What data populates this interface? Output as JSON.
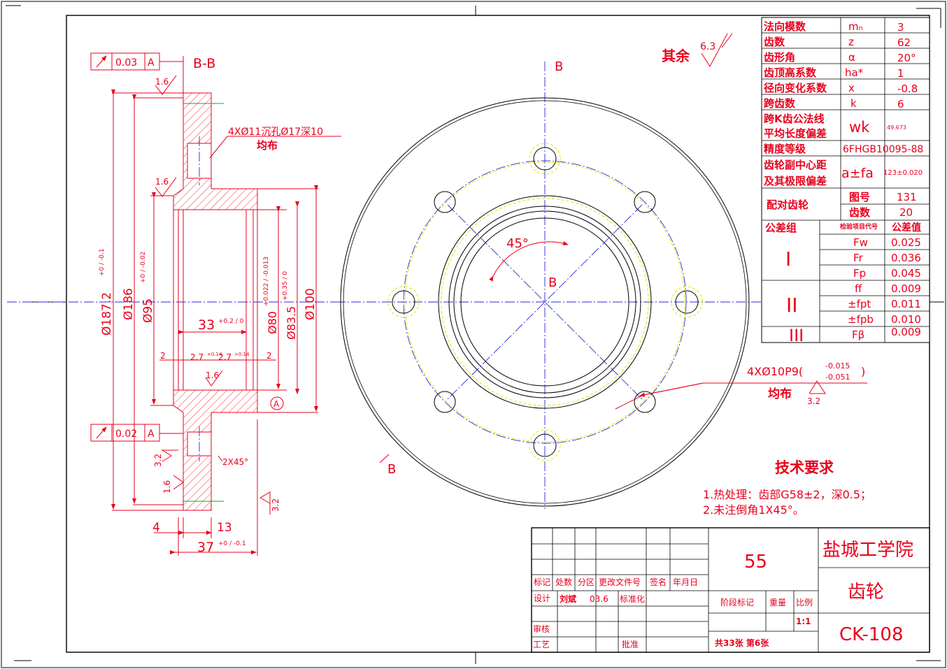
{
  "section_label": "B-B",
  "cut_labels": [
    "B",
    "B",
    "B"
  ],
  "tolerance_frames": [
    {
      "symbol": "↗",
      "value": "0.03",
      "datum": "A"
    },
    {
      "symbol": "↗",
      "value": "0.02",
      "datum": "A"
    }
  ],
  "surface_finish": {
    "general": "其余",
    "general_value": "6.3",
    "marks": [
      "1.6",
      "1.6",
      "1.6",
      "3.2",
      "1.6",
      "3.2",
      "3.2"
    ]
  },
  "callouts": {
    "counterbore": "4XØ11沉孔Ø17深10",
    "counterbore_sub": "均布",
    "pins": "4XØ10P9(",
    "pins_tol_upper": "-0.015",
    "pins_tol_lower": "-0.051",
    "pins_close": ")",
    "pins_sub": "均布",
    "chamfer": "2X45°",
    "angle": "45°",
    "datum": "A"
  },
  "dimensions": {
    "d187": "Ø187.2",
    "d187_tol": "+0 / -0.1",
    "d186": "Ø186",
    "d95": "Ø95",
    "d95_tol": "+0 / -0.02",
    "d80": "Ø80",
    "d80_tol": "+0.022 / -0.013",
    "d83": "Ø83.5",
    "d83_tol": "+0.35 / 0",
    "d100": "Ø100",
    "w33": "33",
    "w33_tol": "+0.2 / 0",
    "w2a": "2",
    "w2b": "2",
    "w27a": "2.7",
    "w27a_tol": "+0.14",
    "w27b": "2.7",
    "w27b_tol": "+0.14",
    "w4": "4",
    "w13": "13",
    "w37": "37",
    "w37_tol": "+0 / -0.1"
  },
  "gear_table": {
    "rows": [
      {
        "label": "法向模数",
        "sym": "mₙ",
        "val": "3"
      },
      {
        "label": "齿数",
        "sym": "z",
        "val": "62"
      },
      {
        "label": "齿形角",
        "sym": "α",
        "val": "20°"
      },
      {
        "label": "齿顶高系数",
        "sym": "ha*",
        "val": "1"
      },
      {
        "label": "径向变化系数",
        "sym": "x",
        "val": "-0.8"
      },
      {
        "label": "跨齿数",
        "sym": "k",
        "val": "6"
      }
    ],
    "wk_label_1": "跨K齿公法线",
    "wk_label_2": "平均长度偏差",
    "wk_sym": "wk",
    "wk_val": "49.673",
    "grade_label": "精度等级",
    "grade_val": "6FHGB10095-88",
    "center_label_1": "齿轮副中心距",
    "center_label_2": "及其极限偏差",
    "center_sym": "a±fa",
    "center_val": "123±0.020",
    "mate_label": "配对齿轮",
    "mate_rows": [
      {
        "sym": "图号",
        "val": "131"
      },
      {
        "sym": "齿数",
        "val": "20"
      }
    ],
    "tol_header_label": "公差组",
    "tol_header_code": "检验项目代号",
    "tol_header_value": "公差值",
    "tol_groups": [
      {
        "group": "I",
        "items": [
          {
            "code": "Fw",
            "value": "0.025"
          },
          {
            "code": "Fr",
            "value": "0.036"
          },
          {
            "code": "Fp",
            "value": "0.045"
          }
        ]
      },
      {
        "group": "II",
        "items": [
          {
            "code": "ff",
            "value": "0.009"
          },
          {
            "code": "±fpt",
            "value": "0.011"
          },
          {
            "code": "±fpb",
            "value": "0.010"
          }
        ]
      },
      {
        "group": "III",
        "items": [
          {
            "code": "Fβ",
            "value": "0.009"
          }
        ]
      }
    ]
  },
  "tech_req": {
    "title": "技术要求",
    "items": [
      "1.热处理：齿部G58±2，深0.5；",
      "2.未注倒角1X45°。"
    ]
  },
  "title_block": {
    "part_no_top": "55",
    "school": "盐城工学院",
    "part_name": "齿轮",
    "drawing_no": "CK-108",
    "headers": [
      "标记",
      "处数",
      "分区",
      "更改文件号",
      "签名",
      "年月日"
    ],
    "design_label": "设计",
    "designer": "刘斌",
    "date": "03.6",
    "standard_label": "标准化",
    "stage_label": "阶段标记",
    "weight_label": "重量",
    "scale_label": "比例",
    "scale": "1:1",
    "review_label": "审核",
    "process_label": "工艺",
    "approve_label": "批准",
    "sheets": "共33张 第6张"
  }
}
